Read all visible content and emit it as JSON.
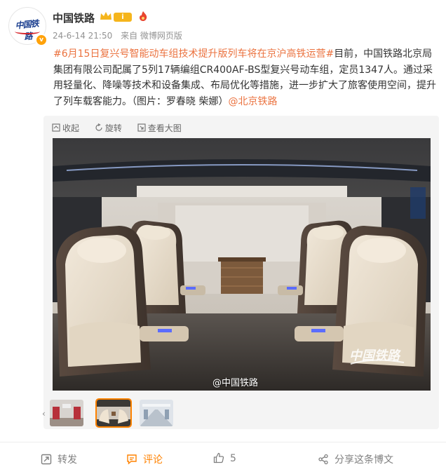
{
  "account": {
    "name": "中国铁路",
    "avatar_text": "中国铁路",
    "level": "i",
    "verified": "v",
    "time": "24-6-14 21:50",
    "source": "来自 微博网页版"
  },
  "post": {
    "topic": "#6月15日复兴号智能动车组技术提升版列车将在京沪高铁运营#",
    "text": "目前，中国铁路北京局集团有限公司配属了5列17辆编组CR400AF-BS型复兴号动车组，定员1347人。通过采用轻量化、降噪等技术和设备集成、布局优化等措施，进一步扩大了旅客使用空间，提升了列车载客能力。（图片：罗春晓 柴娜）",
    "mention": "@北京铁路"
  },
  "media_tools": {
    "collapse": "收起",
    "rotate": "旋转",
    "view_large": "查看大图"
  },
  "photo": {
    "watermark": "@中国铁路",
    "logo_text": "中国铁路"
  },
  "thumbnails": {
    "count": 3,
    "active_index": 1
  },
  "footer": {
    "repost": "转发",
    "comment": "评论",
    "like_count": "5",
    "share": "分享这条博文"
  },
  "colors": {
    "accent": "#ff8200",
    "link": "#eb7340",
    "muted": "#939393"
  }
}
